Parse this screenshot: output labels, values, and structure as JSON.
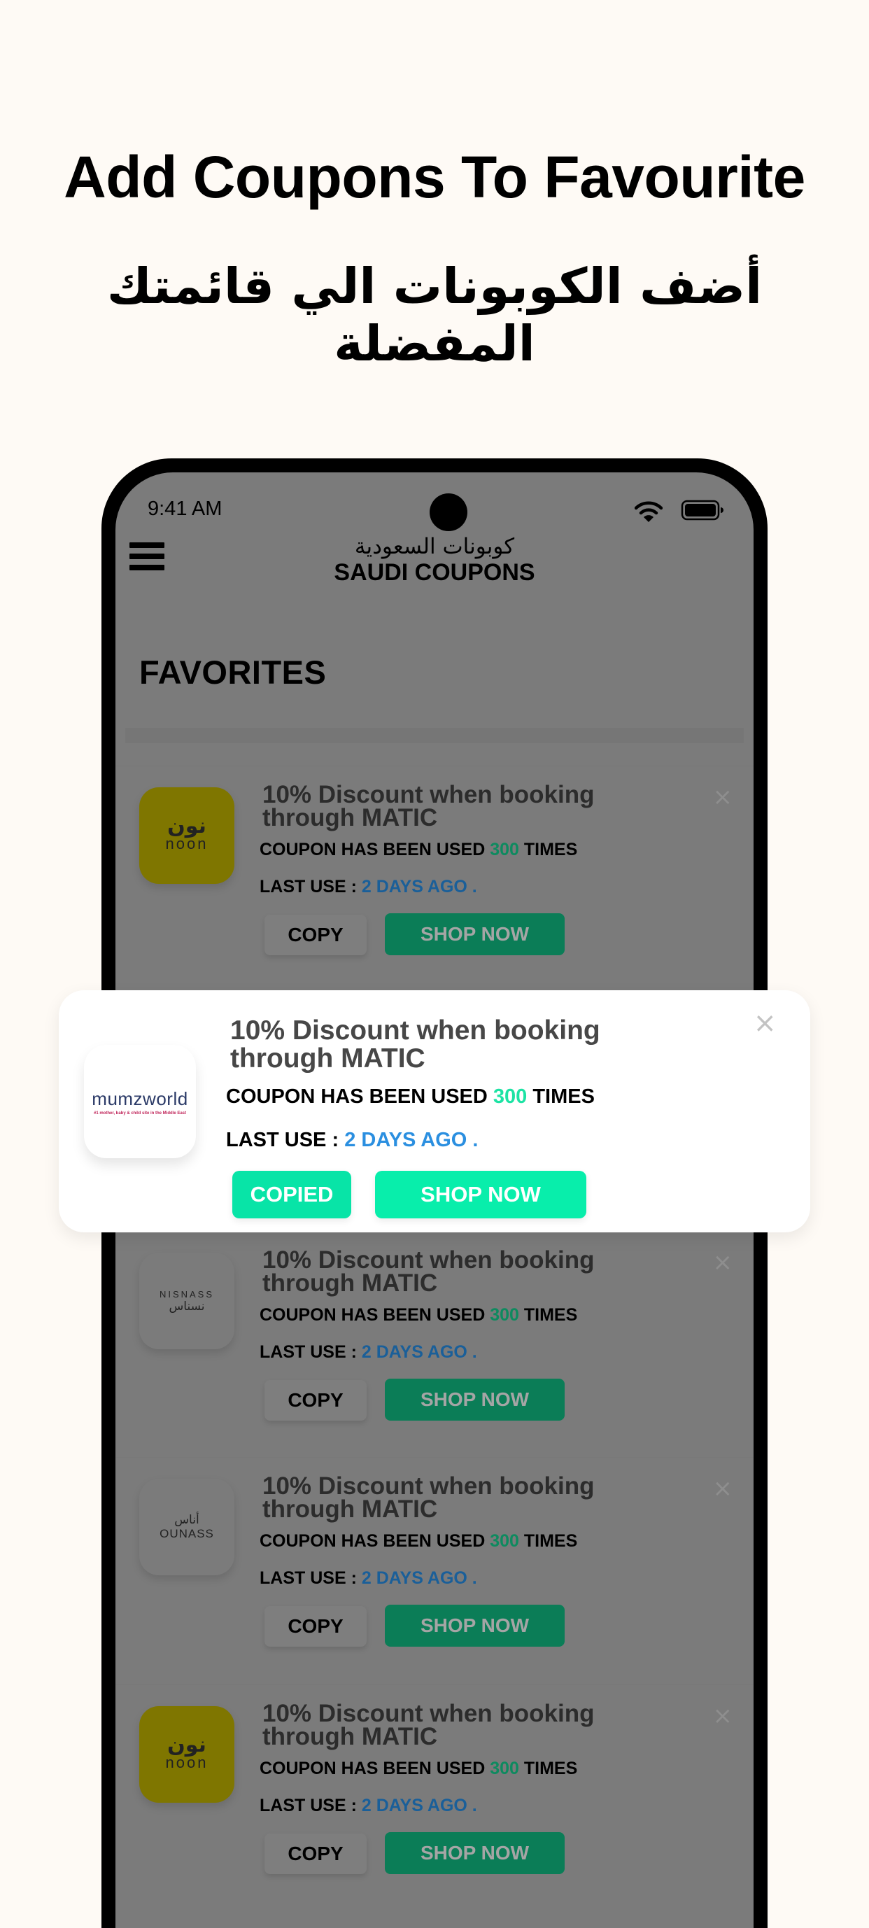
{
  "promo": {
    "title": "Add Coupons To Favourite",
    "subtitle": "أضف الكوبونات الي قائمتك المفضلة"
  },
  "status_bar": {
    "time": "9:41 AM",
    "icons": [
      "wifi-icon",
      "battery-icon"
    ]
  },
  "header": {
    "menu_icon": "hamburger-menu-icon",
    "title_ar": "كوبونات السعودية",
    "title_en": "SAUDI COUPONS"
  },
  "section": {
    "title": "FAVORITES"
  },
  "colors": {
    "accent_green": "#08eeab",
    "used_count_green": "#1de3a4",
    "last_use_blue": "#2b8fe0",
    "page_background": "#fefaf5",
    "noon_yellow": "#feed01"
  },
  "coupons": [
    {
      "brand": "noon",
      "brand_ar": "نون",
      "title": "10% Discount when booking through MATIC",
      "used_prefix": "COUPON HAS BEEN USED",
      "used_count": "300",
      "used_suffix": "TIMES",
      "last_use_label": "LAST USE :",
      "last_use_value": "2 DAYS AGO .",
      "copy_label": "COPY",
      "shop_label": "SHOP NOW",
      "close_icon": "×"
    },
    {
      "brand": "NISNASS",
      "brand_ar": "نسناس",
      "title": "10% Discount when booking through MATIC",
      "used_prefix": "COUPON HAS BEEN USED",
      "used_count": "300",
      "used_suffix": "TIMES",
      "last_use_label": "LAST USE :",
      "last_use_value": "2 DAYS AGO .",
      "copy_label": "COPY",
      "shop_label": "SHOP NOW",
      "close_icon": "×"
    },
    {
      "brand": "OUNASS",
      "brand_ar": "أناس",
      "title": "10% Discount when booking through MATIC",
      "used_prefix": "COUPON HAS BEEN USED",
      "used_count": "300",
      "used_suffix": "TIMES",
      "last_use_label": "LAST USE :",
      "last_use_value": "2 DAYS AGO .",
      "copy_label": "COPY",
      "shop_label": "SHOP NOW",
      "close_icon": "×"
    },
    {
      "brand": "noon",
      "brand_ar": "نون",
      "title": "10% Discount when booking through MATIC",
      "used_prefix": "COUPON HAS BEEN USED",
      "used_count": "300",
      "used_suffix": "TIMES",
      "last_use_label": "LAST USE :",
      "last_use_value": "2 DAYS AGO .",
      "copy_label": "COPY",
      "shop_label": "SHOP NOW",
      "close_icon": "×"
    }
  ],
  "highlighted_coupon": {
    "brand": "mumzworld",
    "brand_tagline": "#1 mother, baby & child site in the Middle East",
    "title": "10% Discount when booking through MATIC",
    "used_prefix": "COUPON HAS BEEN USED",
    "used_count": "300",
    "used_suffix": "TIMES",
    "last_use_label": "LAST USE :",
    "last_use_value": "2 DAYS AGO .",
    "copied_label": "COPIED",
    "shop_label": "SHOP NOW",
    "close_icon": "×"
  }
}
